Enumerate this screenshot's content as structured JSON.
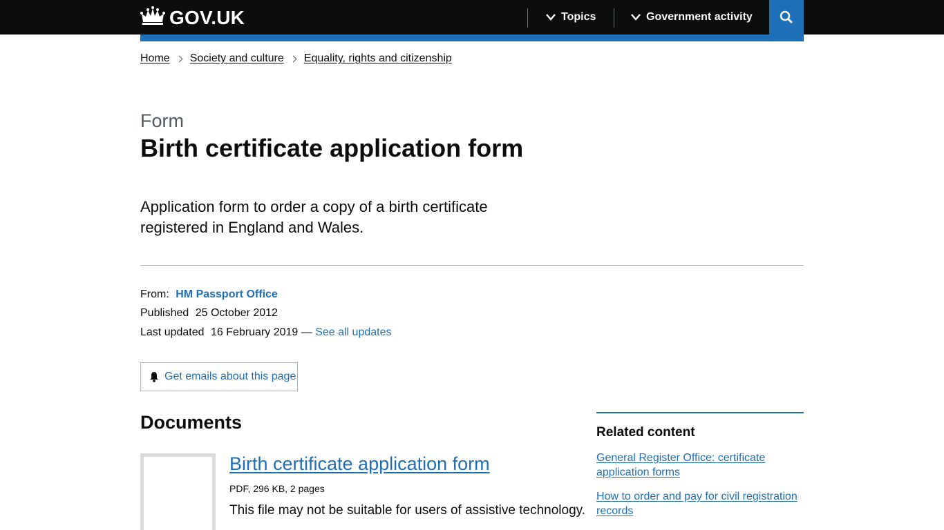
{
  "header": {
    "logo_text": "GOV.UK",
    "nav": [
      {
        "label": "Topics"
      },
      {
        "label": "Government activity"
      }
    ],
    "colors": {
      "background": "#0b0c0c",
      "accent": "#1d70b8"
    }
  },
  "breadcrumbs": [
    {
      "label": "Home"
    },
    {
      "label": "Society and culture"
    },
    {
      "label": "Equality, rights and citizenship"
    }
  ],
  "page": {
    "caption": "Form",
    "title": "Birth certificate application form",
    "lead": "Application form to order a copy of a birth certificate registered in England and Wales."
  },
  "metadata": {
    "from_label": "From:",
    "from_value": "HM Passport Office",
    "published_label": "Published",
    "published_value": "25 October 2012",
    "updated_label": "Last updated",
    "updated_value": "16 February 2019 —",
    "see_updates": "See all updates"
  },
  "email_signup": {
    "label": "Get emails about this page"
  },
  "documents": {
    "heading": "Documents",
    "items": [
      {
        "title": "Birth certificate application form",
        "meta": "PDF, 296 KB, 2 pages",
        "note": "This file may not be suitable for users of assistive technology."
      }
    ]
  },
  "related": {
    "heading": "Related content",
    "links": [
      {
        "label": "General Register Office: certificate application forms"
      },
      {
        "label": "How to order and pay for civil registration records"
      }
    ]
  }
}
